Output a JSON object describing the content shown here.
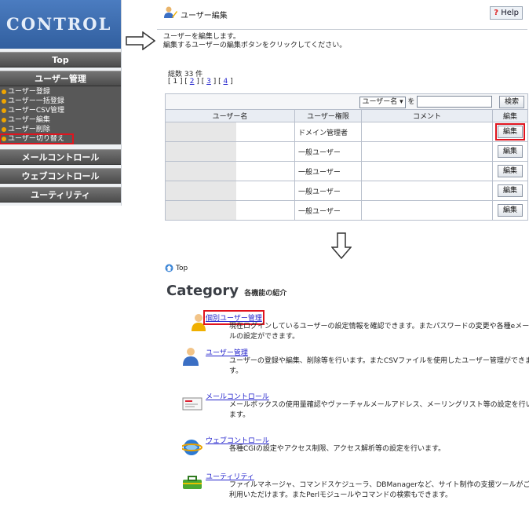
{
  "left_panel": {
    "logo": "CONTROL",
    "top_label": "Top",
    "user_mgmt_label": "ユーザー管理",
    "submenu": [
      "ユーザー登録",
      "ユーザー一括登録",
      "ユーザーCSV管理",
      "ユーザー編集",
      "ユーザー削除",
      "ユーザー切り替え"
    ],
    "mail_label": "メールコントロール",
    "web_label": "ウェブコントロール",
    "utility_label": "ユーティリティ"
  },
  "user_edit": {
    "title": "ユーザー編集",
    "help_label": "Help",
    "help_mark": "?",
    "intro_1": "ユーザーを編集します。",
    "intro_2": "編集するユーザーの編集ボタンをクリックしてください。",
    "total": "総数 33 件",
    "pager": {
      "b1": "[",
      "p1": "1",
      "b2": "] [",
      "p2": "2",
      "b3": "] [",
      "p3": "3",
      "b4": "] [",
      "p4": "4",
      "b5": "]"
    },
    "search": {
      "field": "ユーザー名",
      "suffix": "を",
      "button": "検索"
    },
    "columns": [
      "ユーザー名",
      "ユーザー権限",
      "コメント",
      "編集"
    ],
    "rows": [
      {
        "role": "ドメイン管理者",
        "edit": "編集"
      },
      {
        "role": "一般ユーザー",
        "edit": "編集"
      },
      {
        "role": "一般ユーザー",
        "edit": "編集"
      },
      {
        "role": "一般ユーザー",
        "edit": "編集"
      },
      {
        "role": "一般ユーザー",
        "edit": "編集"
      }
    ]
  },
  "category_page": {
    "breadcrumb": "Top",
    "heading": "Category",
    "heading_sub": "各機能の紹介",
    "items": [
      {
        "link": "個別ユーザー管理",
        "desc": "現在ログインしているユーザーの設定情報を確認できます。またパスワードの変更や各種eメールの設定ができます。"
      },
      {
        "link": "ユーザー管理",
        "desc": "ユーザーの登録や編集、削除等を行います。またCSVファイルを使用したユーザー管理ができます。"
      },
      {
        "link": "メールコントロール",
        "desc": "メールボックスの使用量確認やヴァーチャルメールアドレス、メーリングリスト等の設定を行います。"
      },
      {
        "link": "ウェブコントロール",
        "desc": "各種CGIの設定やアクセス制限、アクセス解析等の設定を行います。"
      },
      {
        "link": "ユーティリティ",
        "desc": "ファイルマネージャ、コマンドスケジューラ、DBManagerなど、サイト制作の支援ツールがご利用いただけます。またPerlモジュールやコマンドの検索もできます。"
      }
    ]
  }
}
